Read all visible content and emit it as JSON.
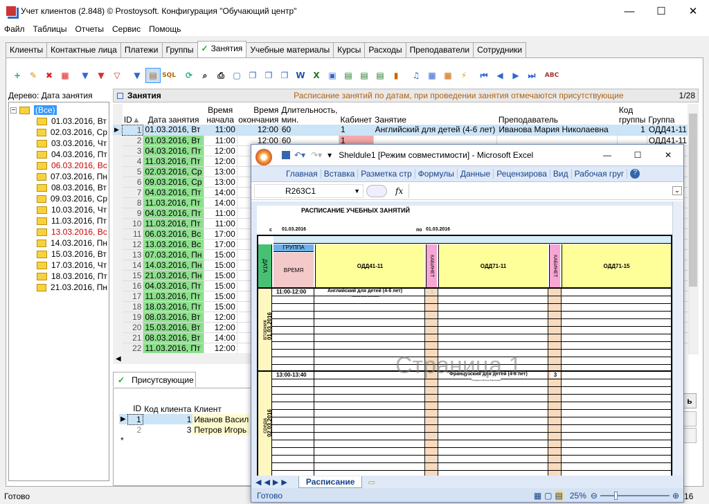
{
  "window": {
    "title": "Учет клиентов (2.848) © Prostoysoft. Конфигурация \"Обучающий центр\"",
    "min": "—",
    "max": "☐",
    "close": "✕"
  },
  "menu": [
    "Файл",
    "Таблицы",
    "Отчеты",
    "Сервис",
    "Помощь"
  ],
  "tabs": [
    "Клиенты",
    "Контактные лица",
    "Платежи",
    "Группы",
    "Занятия",
    "Учебные материалы",
    "Курсы",
    "Расходы",
    "Преподаватели",
    "Сотрудники"
  ],
  "active_tab_check": "✓",
  "toolbar": [
    "add-icon",
    "edit-icon",
    "delete-icon",
    "delete-all-icon",
    "filter-icon",
    "filter-clear-icon",
    "filter-off-icon",
    "filter-group-icon",
    "filter-select-icon",
    "sql-icon",
    "refresh-icon",
    "find-icon",
    "print-icon",
    "preview-icon",
    "copy-icon",
    "copy2-icon",
    "copy3-icon",
    "word-icon",
    "excel-icon",
    "export-icon",
    "csv-icon",
    "export2-icon",
    "export3-icon",
    "chart-icon",
    "music-icon",
    "report-icon",
    "report2-icon",
    "flash-icon",
    "first-icon",
    "prev-icon",
    "next-icon",
    "last-icon",
    "spell-icon"
  ],
  "toolbar_labels": {
    "sql": "SQL"
  },
  "tree": {
    "header": "Дерево: Дата занятия",
    "root": "(Все)",
    "items": [
      {
        "label": "01.03.2016, Вт",
        "red": false
      },
      {
        "label": "02.03.2016, Ср",
        "red": false
      },
      {
        "label": "03.03.2016, Чт",
        "red": false
      },
      {
        "label": "04.03.2016, Пт",
        "red": false
      },
      {
        "label": "06.03.2016, Вс",
        "red": true
      },
      {
        "label": "07.03.2016, Пн",
        "red": false
      },
      {
        "label": "08.03.2016, Вт",
        "red": false
      },
      {
        "label": "09.03.2016, Ср",
        "red": false
      },
      {
        "label": "10.03.2016, Чт",
        "red": false
      },
      {
        "label": "11.03.2016, Пт",
        "red": false
      },
      {
        "label": "13.03.2016, Вс",
        "red": true
      },
      {
        "label": "14.03.2016, Пн",
        "red": false
      },
      {
        "label": "15.03.2016, Вт",
        "red": false
      },
      {
        "label": "17.03.2016, Чт",
        "red": false
      },
      {
        "label": "18.03.2016, Пт",
        "red": false
      },
      {
        "label": "21.03.2016, Пн",
        "red": false
      }
    ]
  },
  "panel": {
    "title": "Занятия",
    "desc": "Расписание занятий по датам, при проведении занятия отмечаются присутствующие",
    "page": "1/28"
  },
  "grid": {
    "headers": {
      "id": "ID",
      "date": "Дата занятия",
      "start": "Время начала",
      "end": "Время окончания",
      "duration": "Длительность, мин.",
      "room": "Кабинет",
      "lesson": "Занятие",
      "teacher": "Преподаватель",
      "groupcode": "Код группы",
      "group": "Группа"
    },
    "rows": [
      {
        "id": "1",
        "date": "01.03.2016, Вт",
        "start": "11:00",
        "end": "12:00",
        "duration": "60",
        "room": "1",
        "lesson": "Английский для детей (4-6 лет)",
        "teacher": "Иванова Мария Николаевна",
        "code": "1",
        "group": "ОДД41-11"
      },
      {
        "id": "2",
        "date": "01.03.2016, Вт",
        "start": "11:00",
        "end": "12:00",
        "duration": "60",
        "room": "1",
        "lesson": "",
        "teacher": "",
        "code": "",
        "group": "ОДД41-11"
      },
      {
        "id": "3",
        "date": "04.03.2016, Пт",
        "start": "12:00",
        "end": "",
        "duration": "",
        "room": "",
        "lesson": "",
        "teacher": "",
        "code": "",
        "group": ""
      },
      {
        "id": "4",
        "date": "11.03.2016, Пт",
        "start": "12:00",
        "end": "",
        "duration": "",
        "room": "",
        "lesson": "",
        "teacher": "",
        "code": "",
        "group": ""
      },
      {
        "id": "5",
        "date": "02.03.2016, Ср",
        "start": "13:00",
        "end": "",
        "duration": "",
        "room": "",
        "lesson": "",
        "teacher": "",
        "code": "",
        "group": ""
      },
      {
        "id": "6",
        "date": "09.03.2016, Ср",
        "start": "13:00",
        "end": "",
        "duration": "",
        "room": "",
        "lesson": "",
        "teacher": "",
        "code": "",
        "group": ""
      },
      {
        "id": "7",
        "date": "04.03.2016, Пт",
        "start": "14:00",
        "end": "",
        "duration": "",
        "room": "",
        "lesson": "",
        "teacher": "",
        "code": "",
        "group": ""
      },
      {
        "id": "8",
        "date": "11.03.2016, Пт",
        "start": "14:00",
        "end": "",
        "duration": "",
        "room": "",
        "lesson": "",
        "teacher": "",
        "code": "",
        "group": ""
      },
      {
        "id": "9",
        "date": "04.03.2016, Пт",
        "start": "11:00",
        "end": "",
        "duration": "",
        "room": "",
        "lesson": "",
        "teacher": "",
        "code": "",
        "group": ""
      },
      {
        "id": "10",
        "date": "11.03.2016, Пт",
        "start": "11:00",
        "end": "",
        "duration": "",
        "room": "",
        "lesson": "",
        "teacher": "",
        "code": "",
        "group": ""
      },
      {
        "id": "11",
        "date": "06.03.2016, Вс",
        "start": "17:00",
        "end": "",
        "duration": "",
        "room": "",
        "lesson": "",
        "teacher": "",
        "code": "",
        "group": ""
      },
      {
        "id": "12",
        "date": "13.03.2016, Вс",
        "start": "17:00",
        "end": "",
        "duration": "",
        "room": "",
        "lesson": "",
        "teacher": "",
        "code": "",
        "group": ""
      },
      {
        "id": "13",
        "date": "07.03.2016, Пн",
        "start": "15:00",
        "end": "",
        "duration": "",
        "room": "",
        "lesson": "",
        "teacher": "",
        "code": "",
        "group": ""
      },
      {
        "id": "14",
        "date": "14.03.2016, Пн",
        "start": "15:00",
        "end": "",
        "duration": "",
        "room": "",
        "lesson": "",
        "teacher": "",
        "code": "",
        "group": ""
      },
      {
        "id": "15",
        "date": "21.03.2016, Пн",
        "start": "15:00",
        "end": "",
        "duration": "",
        "room": "",
        "lesson": "",
        "teacher": "",
        "code": "",
        "group": ""
      },
      {
        "id": "16",
        "date": "04.03.2016, Пт",
        "start": "15:00",
        "end": "",
        "duration": "",
        "room": "",
        "lesson": "",
        "teacher": "",
        "code": "",
        "group": ""
      },
      {
        "id": "17",
        "date": "11.03.2016, Пт",
        "start": "15:00",
        "end": "",
        "duration": "",
        "room": "",
        "lesson": "",
        "teacher": "",
        "code": "",
        "group": ""
      },
      {
        "id": "18",
        "date": "18.03.2016, Пт",
        "start": "15:00",
        "end": "",
        "duration": "",
        "room": "",
        "lesson": "",
        "teacher": "",
        "code": "",
        "group": ""
      },
      {
        "id": "19",
        "date": "08.03.2016, Вт",
        "start": "12:00",
        "end": "",
        "duration": "",
        "room": "",
        "lesson": "",
        "teacher": "",
        "code": "",
        "group": ""
      },
      {
        "id": "20",
        "date": "15.03.2016, Вт",
        "start": "12:00",
        "end": "",
        "duration": "",
        "room": "",
        "lesson": "",
        "teacher": "",
        "code": "",
        "group": ""
      },
      {
        "id": "21",
        "date": "08.03.2016, Вт",
        "start": "14:00",
        "end": "",
        "duration": "",
        "room": "",
        "lesson": "",
        "teacher": "",
        "code": "",
        "group": ""
      },
      {
        "id": "22",
        "date": "11.03.2016, Пт",
        "start": "12:00",
        "end": "",
        "duration": "",
        "room": "",
        "lesson": "",
        "teacher": "",
        "code": "",
        "group": ""
      }
    ]
  },
  "subtab": {
    "label": "Присутсвующие",
    "check": "✓"
  },
  "subgrid": {
    "headers": {
      "id": "ID",
      "code": "Код клиента",
      "client": "Клиент"
    },
    "rows": [
      {
        "id": "1",
        "code": "1",
        "client": "Иванов Васил"
      },
      {
        "id": "2",
        "code": "3",
        "client": "Петров Игорь"
      }
    ],
    "new_row": "*"
  },
  "right_btn": "ь",
  "status": {
    "left": "Готово",
    "right": "16"
  },
  "excel": {
    "title": "Sheldule1  [Режим совместимости] - Microsoft Excel",
    "ribbon": [
      "Главная",
      "Вставка",
      "Разметка стр",
      "Формулы",
      "Данные",
      "Рецензирова",
      "Вид",
      "Рабочая груг"
    ],
    "namebox": "R263C1",
    "fx": "fx",
    "sheet_title": "РАСПИСАНИЕ УЧЕБНЫХ ЗАНЯТИЙ",
    "from_label": "с",
    "from_date": "01.03.2016",
    "to_label": "по",
    "to_date": "01.03.2016",
    "group_label": "ГРУППА",
    "time_label": "ВРЕМЯ",
    "date_label": "ДАТА",
    "room_label": "КАБИНЕТ",
    "groups": [
      "ОДД41-11",
      "ОДД71-11",
      "ОДД71-15"
    ],
    "page_watermark": "Страница 1",
    "day1": {
      "name": "вторник",
      "date": "01.03.2016",
      "time": "11:00-12:00",
      "lesson": "Английский для детей (4-6 лет)",
      "teacher": "Иванова Мария Николаевна",
      "room": "1"
    },
    "day2": {
      "name": "среда",
      "date": "02.03.2016",
      "time": "13:00-13:40",
      "lesson": "Французский для детей (4-6 лет)",
      "teacher": "Поздрина Наталья Борисовна",
      "room": "3"
    },
    "sheet_tab": "Расписание",
    "status": "Готово",
    "zoom": "25%"
  }
}
